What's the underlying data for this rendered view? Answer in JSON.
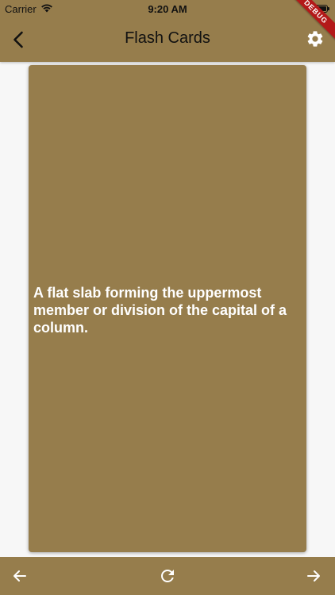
{
  "status_bar": {
    "carrier": "Carrier",
    "time": "9:20 AM"
  },
  "app_bar": {
    "title": "Flash Cards"
  },
  "debug_banner": "DEBUG",
  "card": {
    "text": "A flat slab forming the uppermost member or division of the capital of a column."
  },
  "theme": {
    "primary": "#967d4c",
    "background": "#f7f7f7",
    "card_text": "#ffffff",
    "banner": "#b31919"
  },
  "icons": {
    "back": "chevron-left-icon",
    "settings": "gear-icon",
    "previous": "arrow-left-icon",
    "refresh": "refresh-icon",
    "next": "arrow-right-icon"
  }
}
